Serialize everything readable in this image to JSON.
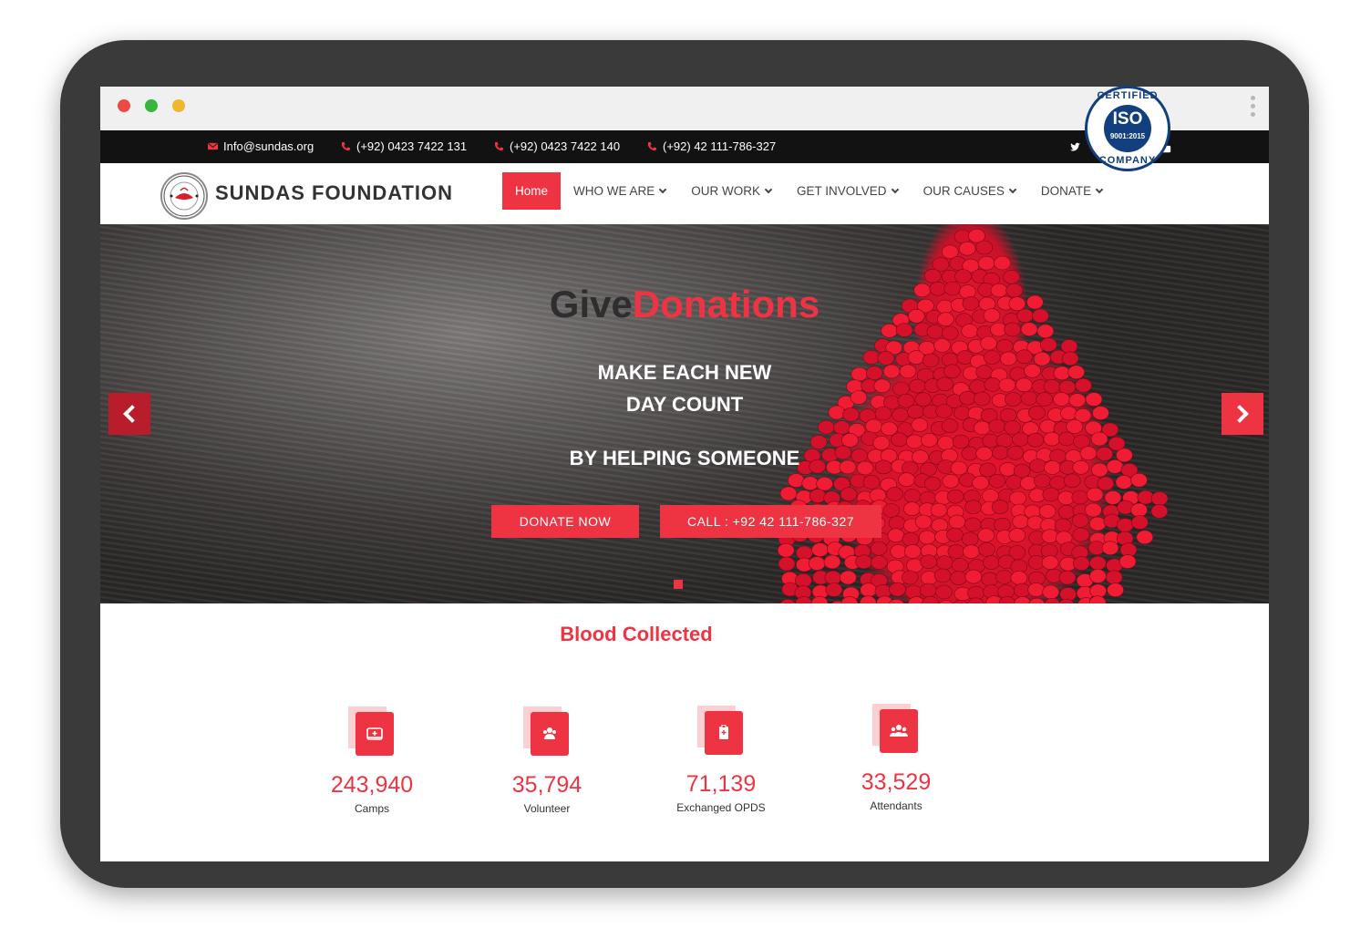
{
  "topbar": {
    "email": "Info@sundas.org",
    "phones": [
      "(+92) 0423 7422 131",
      "(+92) 0423 7422 140",
      "(+92) 42 111-786-327"
    ],
    "social": [
      "twitter-icon",
      "facebook-icon",
      "instagram-icon",
      "youtube-icon"
    ]
  },
  "brand": {
    "name": "SUNDAS FOUNDATION"
  },
  "nav": {
    "items": [
      {
        "label": "Home"
      },
      {
        "label": "WHO WE ARE"
      },
      {
        "label": "OUR WORK"
      },
      {
        "label": "GET INVOLVED"
      },
      {
        "label": "OUR CAUSES"
      },
      {
        "label": "DONATE"
      }
    ]
  },
  "iso": {
    "top": "CERTIFIED",
    "title": "ISO",
    "code": "9001:2015",
    "bottom": "COMPANY"
  },
  "hero": {
    "title_a": "Give",
    "title_b": "Donations",
    "line1": "MAKE EACH NEW",
    "line2": "DAY COUNT",
    "line3": "BY HELPING SOMEONE",
    "btn_donate": "DONATE NOW",
    "btn_call": "CALL : +92 42 111-786-327"
  },
  "stats": {
    "title": "Blood Collected",
    "items": [
      {
        "value": "243,940",
        "label": "Camps",
        "icon": "hospital-bed-icon"
      },
      {
        "value": "35,794",
        "label": "Volunteer",
        "icon": "volunteer-icon"
      },
      {
        "value": "71,139",
        "label": "Exchanged OPDS",
        "icon": "clipboard-icon"
      },
      {
        "value": "33,529",
        "label": "Attendants",
        "icon": "group-icon"
      }
    ]
  },
  "colors": {
    "accent": "#ee3443",
    "dark": "#121212",
    "iso_blue": "#123f7d"
  }
}
